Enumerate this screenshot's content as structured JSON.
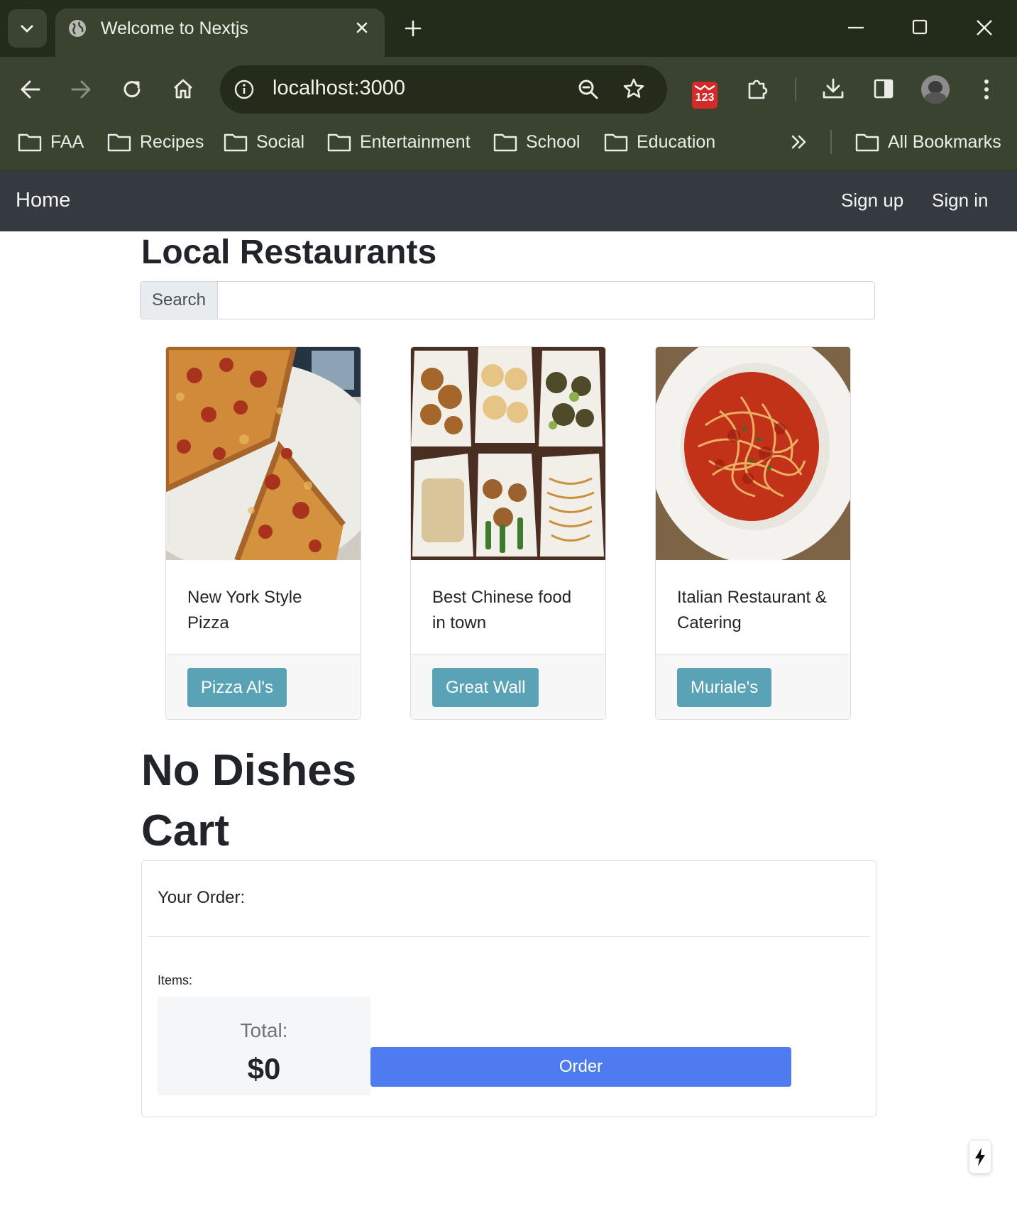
{
  "browser": {
    "tab_title": "Welcome to Nextjs",
    "url": "localhost:3000",
    "extension_badge": "123",
    "bookmarks": [
      "FAA",
      "Recipes",
      "Social",
      "Entertainment",
      "School",
      "Education"
    ],
    "all_bookmarks_label": "All Bookmarks"
  },
  "navbar": {
    "home": "Home",
    "sign_up": "Sign up",
    "sign_in": "Sign in"
  },
  "main": {
    "title": "Local Restaurants",
    "search_label": "Search",
    "search_value": "",
    "restaurants": [
      {
        "description": "New York Style Pizza",
        "name": "Pizza Al's",
        "image": "pizza-image"
      },
      {
        "description": "Best Chinese food in town",
        "name": "Great Wall",
        "image": "chinese-food-image"
      },
      {
        "description": "Italian Restaurant & Catering",
        "name": "Muriale's",
        "image": "spaghetti-image"
      }
    ],
    "dishes_heading": "No Dishes",
    "cart_heading": "Cart"
  },
  "cart": {
    "your_order": "Your Order:",
    "items_label": "Items:",
    "total_label": "Total:",
    "total_value": "$0",
    "order_button": "Order"
  },
  "colors": {
    "navbar_bg": "#343a40",
    "info_button": "#5aa2b5",
    "order_button": "#4f7bf0",
    "browser_frame": "#3a4330"
  }
}
